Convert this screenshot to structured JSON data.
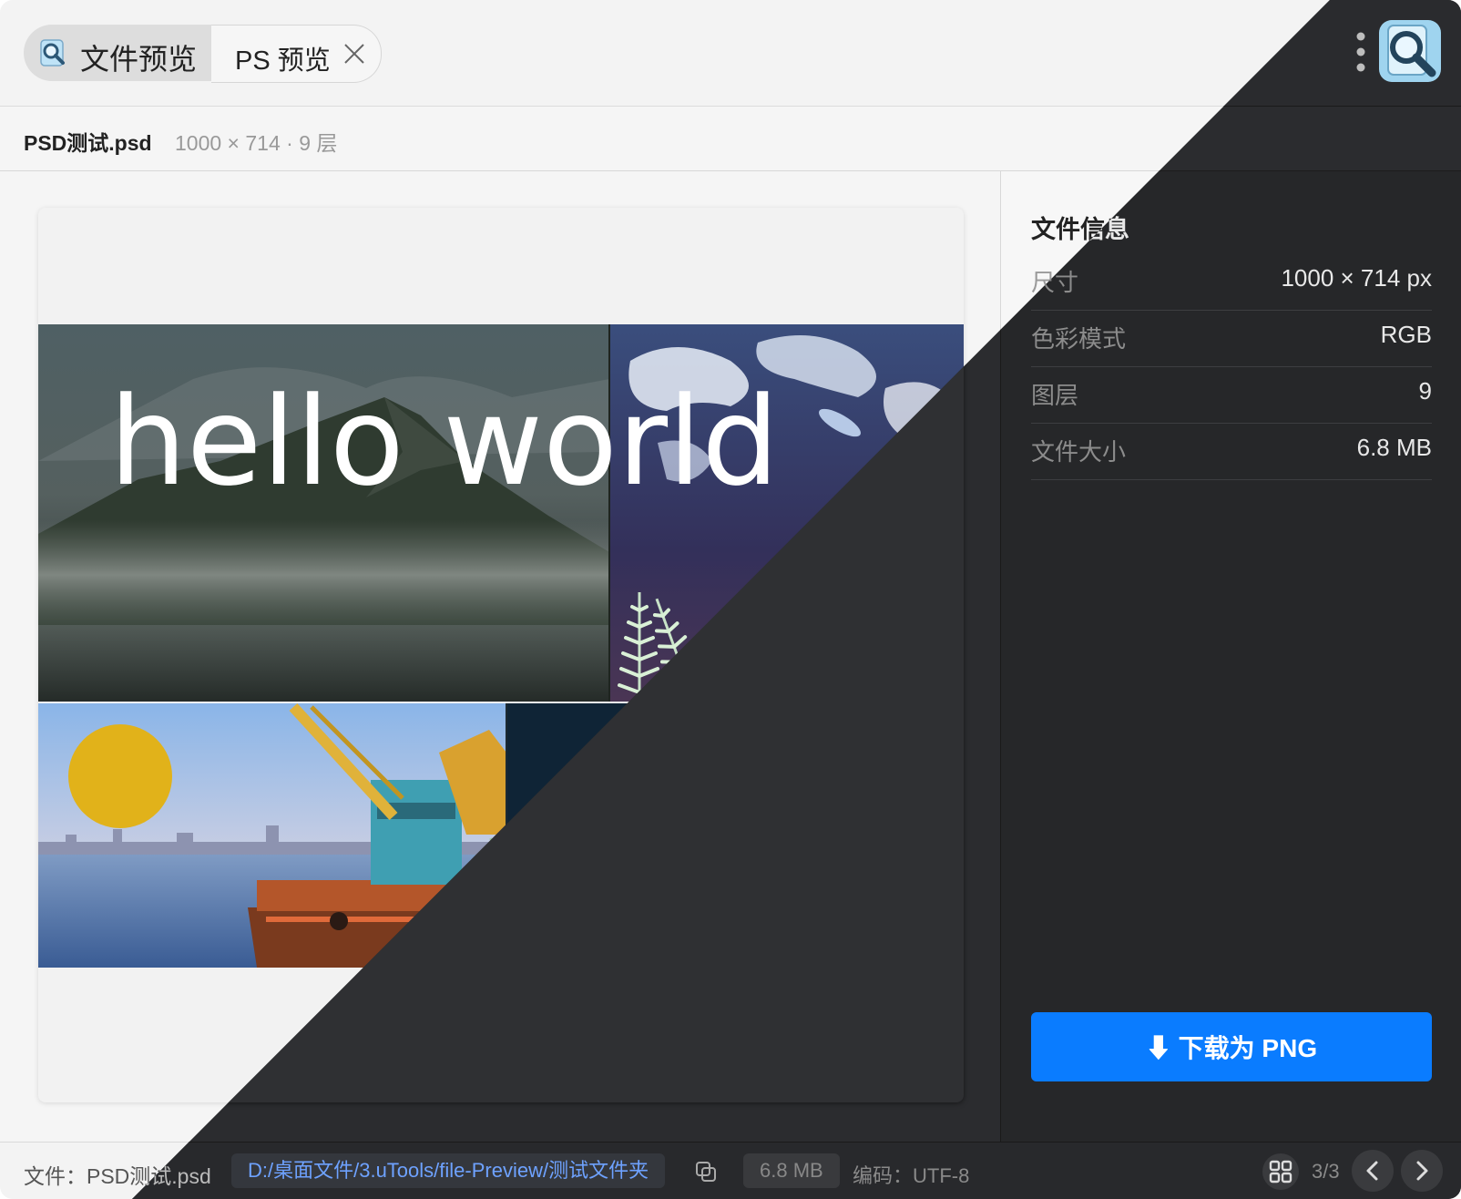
{
  "tabs": {
    "main_label": "文件预览",
    "ps_label": "PS 预览"
  },
  "file_header": {
    "name": "PSD测试.psd",
    "meta": "1000 × 714 · 9 层"
  },
  "preview": {
    "overlay_text": "hello world"
  },
  "sidebar": {
    "title": "文件信息",
    "rows": [
      {
        "label": "尺寸",
        "value": "1000 × 714 px"
      },
      {
        "label": "色彩模式",
        "value": "RGB"
      },
      {
        "label": "图层",
        "value": "9"
      },
      {
        "label": "文件大小",
        "value": "6.8 MB"
      }
    ],
    "download_label": "⬇ 下载为 PNG"
  },
  "status": {
    "file_label": "文件：PSD测试.psd",
    "path": "D:/桌面文件/3.uTools/file-Preview/测试文件夹",
    "size": "6.8 MB",
    "encoding": "编码：UTF-8",
    "page": "3/3"
  },
  "icons": {
    "app": "magnifier-document-icon",
    "close": "close-icon",
    "more": "kebab-menu-icon",
    "copy": "copy-icon",
    "grid": "grid-icon",
    "prev": "chevron-left-icon",
    "next": "chevron-right-icon"
  },
  "colors": {
    "accent": "#0a7cff",
    "dark_bg": "#2b2c2f",
    "light_bg": "#f5f5f5",
    "path_link": "#3a7bd5"
  }
}
